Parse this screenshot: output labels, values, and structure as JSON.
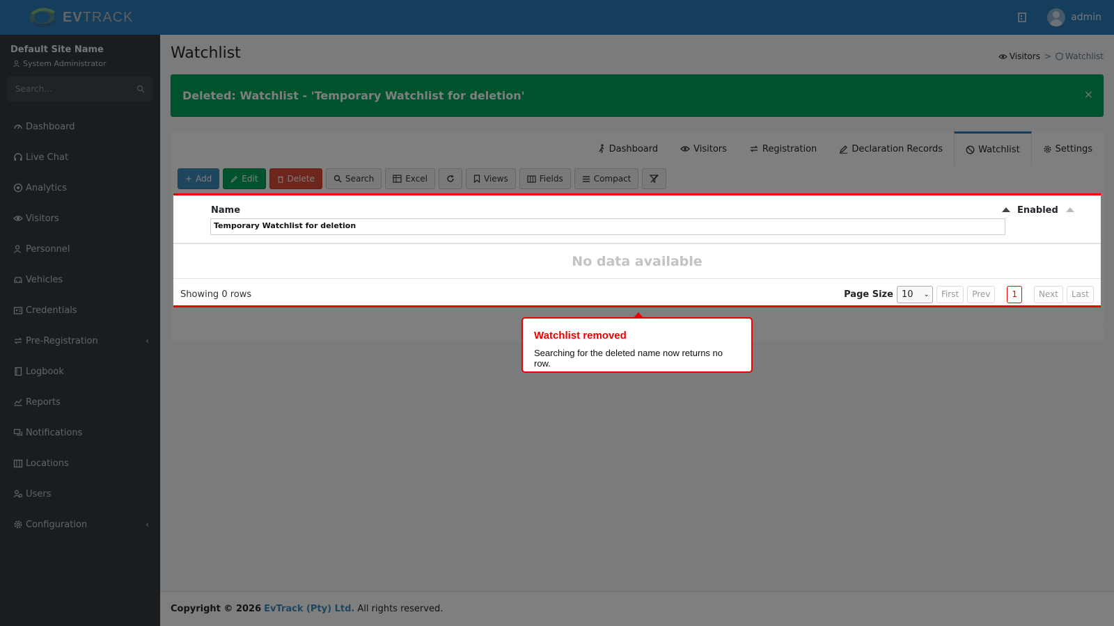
{
  "header": {
    "logo_text_bold": "EV",
    "logo_text_thin": "TRACK",
    "user": "admin"
  },
  "sidebar": {
    "site_name": "Default Site Name",
    "role": "System Administrator",
    "search_placeholder": "Search...",
    "items": [
      {
        "label": "Dashboard",
        "icon": "dashboard-icon"
      },
      {
        "label": "Live Chat",
        "icon": "headset-icon"
      },
      {
        "label": "Analytics",
        "icon": "target-icon"
      },
      {
        "label": "Visitors",
        "icon": "eye-icon"
      },
      {
        "label": "Personnel",
        "icon": "user-icon"
      },
      {
        "label": "Vehicles",
        "icon": "car-icon"
      },
      {
        "label": "Credentials",
        "icon": "id-card-icon"
      },
      {
        "label": "Pre-Registration",
        "icon": "swap-icon"
      },
      {
        "label": "Logbook",
        "icon": "book-icon"
      },
      {
        "label": "Reports",
        "icon": "chart-icon"
      },
      {
        "label": "Notifications",
        "icon": "chat-icon"
      },
      {
        "label": "Locations",
        "icon": "map-icon"
      },
      {
        "label": "Users",
        "icon": "users-icon"
      },
      {
        "label": "Configuration",
        "icon": "gear-icon"
      }
    ]
  },
  "page": {
    "title": "Watchlist",
    "breadcrumb": [
      "Visitors",
      ">",
      "Watchlist"
    ]
  },
  "alert": {
    "message": "Deleted: Watchlist - 'Temporary Watchlist for deletion'",
    "close": "×"
  },
  "tabs": [
    {
      "label": "Dashboard",
      "icon": "walk-icon"
    },
    {
      "label": "Visitors",
      "icon": "eye-icon"
    },
    {
      "label": "Registration",
      "icon": "swap-icon"
    },
    {
      "label": "Declaration Records",
      "icon": "edit-icon"
    },
    {
      "label": "Watchlist",
      "icon": "ban-icon",
      "active": true
    },
    {
      "label": "Settings",
      "icon": "gear-icon"
    }
  ],
  "toolbar": {
    "add": "Add",
    "edit": "Edit",
    "delete": "Delete",
    "search": "Search",
    "excel": "Excel",
    "views": "Views",
    "fields": "Fields",
    "compact": "Compact"
  },
  "grid": {
    "columns": [
      "Name",
      "Enabled"
    ],
    "filter_value": "Temporary Watchlist for deletion",
    "empty": "No data available",
    "showing": "Showing 0 rows",
    "page_size_label": "Page Size",
    "page_size": "10",
    "pager": {
      "first": "First",
      "prev": "Prev",
      "current": "1",
      "next": "Next",
      "last": "Last"
    }
  },
  "tooltip": {
    "title": "Watchlist removed",
    "body": "Searching for the deleted name now returns no row."
  },
  "footer": {
    "prefix": "Copyright © 2026",
    "company": "EvTrack (Pty) Ltd.",
    "suffix": "All rights reserved."
  }
}
